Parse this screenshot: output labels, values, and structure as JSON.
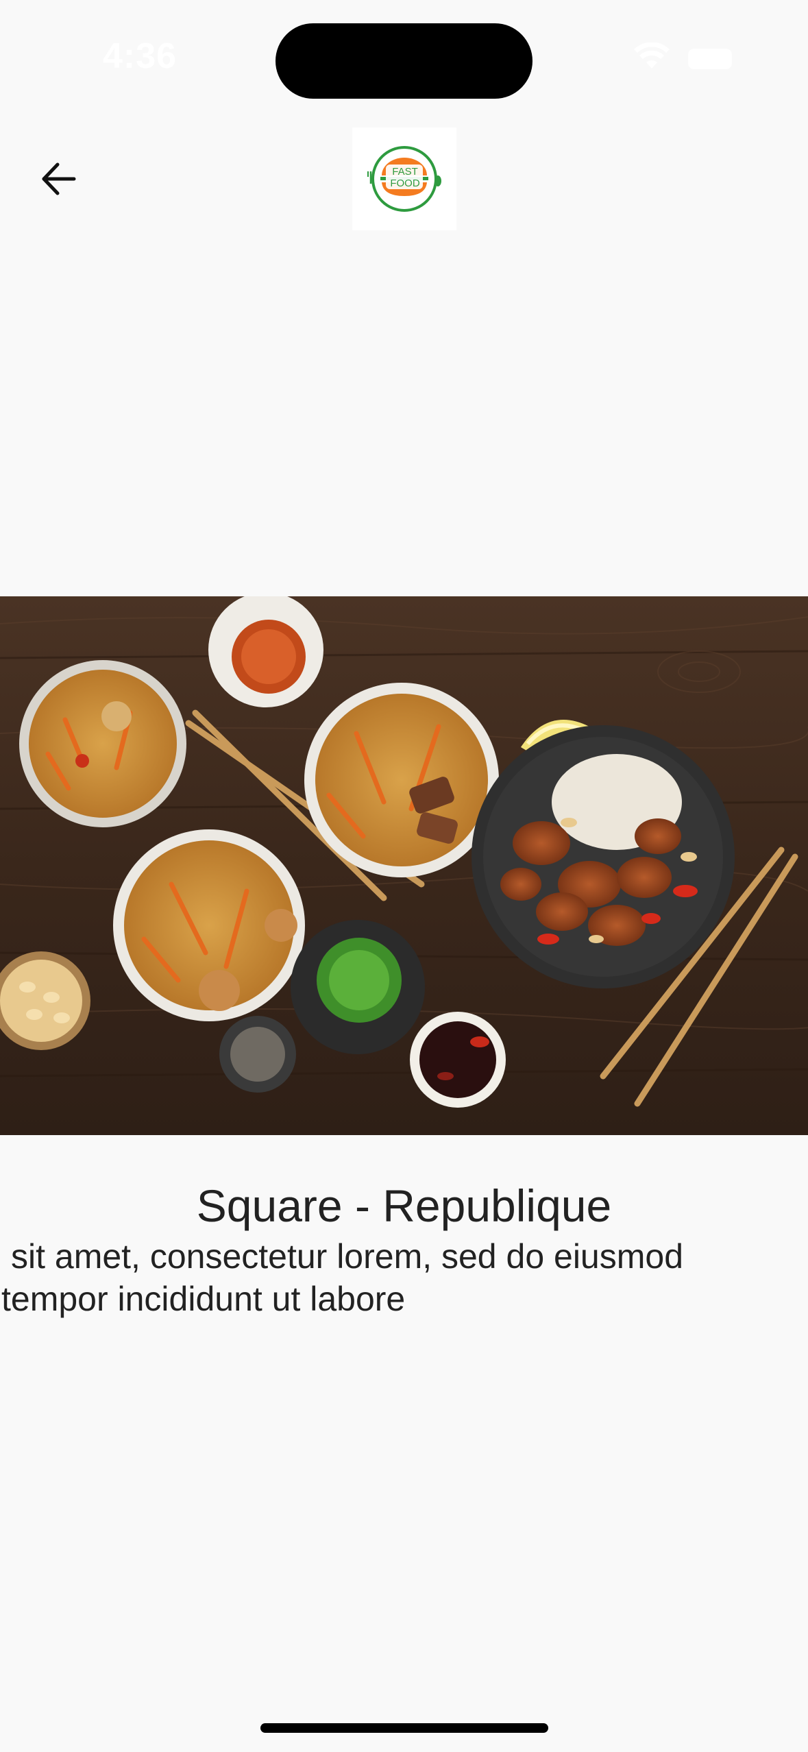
{
  "status_bar": {
    "time": "4:36",
    "icons": [
      "wifi-icon",
      "battery-icon"
    ]
  },
  "header": {
    "back_icon": "arrow-left-icon",
    "logo": {
      "text_line_1": "FAST",
      "text_line_2": "FOOD",
      "colors": {
        "orange": "#f47b20",
        "green": "#2e9b3f"
      }
    }
  },
  "hero": {
    "image": "food-spread-photo"
  },
  "restaurant": {
    "name": "Square - Republique",
    "description_line_1": "sit amet, consectetur lorem, sed do eiusmod",
    "description_line_2": "tempor incididunt ut labore"
  },
  "colors": {
    "background": "#f9f9f9",
    "text": "#222222",
    "table_wood": "#3b2a1f"
  }
}
